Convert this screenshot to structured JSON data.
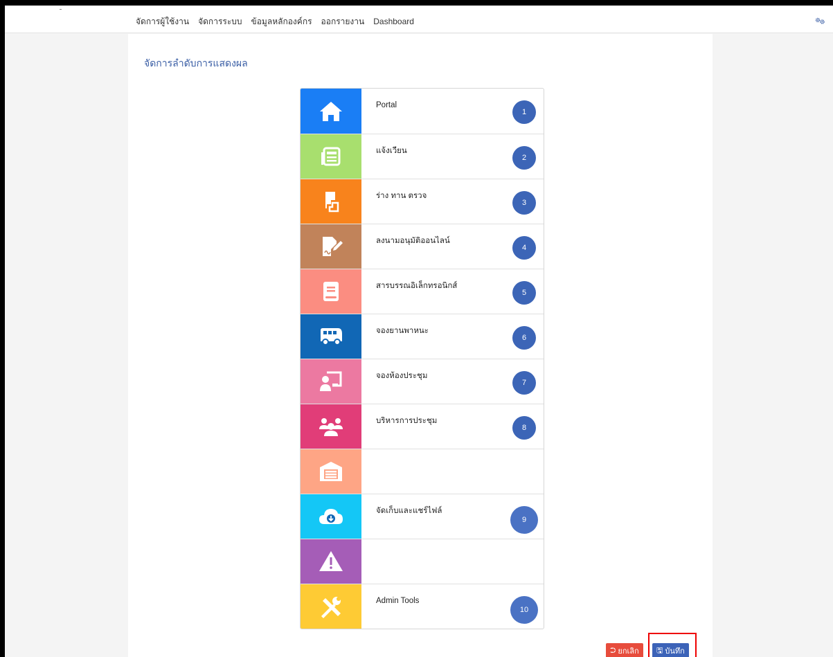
{
  "nav": {
    "items": [
      "จัดการผู้ใช้งาน",
      "จัดการระบบ",
      "ข้อมูลหลักองค์กร",
      "ออกรายงาน",
      "Dashboard"
    ],
    "settings_icon": "gears-icon"
  },
  "page": {
    "title": "จัดการลำดับการแสดงผล"
  },
  "modules": [
    {
      "label": "Portal",
      "order": "1",
      "color": "#1a7ef5",
      "icon": "home-icon"
    },
    {
      "label": "แจ้งเวียน",
      "order": "2",
      "color": "#a8df6e",
      "icon": "newspaper-icon"
    },
    {
      "label": "ร่าง ทาน ตรวจ",
      "order": "3",
      "color": "#f8831c",
      "icon": "draft-icon"
    },
    {
      "label": "ลงนามอนุมัติออนไลน์",
      "order": "4",
      "color": "#c1835a",
      "icon": "signature-icon"
    },
    {
      "label": "สารบรรณอิเล็กทรอนิกส์",
      "order": "5",
      "color": "#fb8d81",
      "icon": "book-icon"
    },
    {
      "label": "จองยานพาหนะ",
      "order": "6",
      "color": "#1167b5",
      "icon": "van-icon"
    },
    {
      "label": "จองห้องประชุม",
      "order": "7",
      "color": "#ec79a1",
      "icon": "presentation-icon"
    },
    {
      "label": "บริหารการประชุม",
      "order": "8",
      "color": "#e13d78",
      "icon": "users-icon"
    },
    {
      "label": "",
      "order": "",
      "color": "#fea585",
      "icon": "warehouse-icon"
    },
    {
      "label": "จัดเก็บและแชร์ไฟล์",
      "order": "9",
      "color": "#14c7f6",
      "icon": "cloud-download-icon"
    },
    {
      "label": "",
      "order": "",
      "color": "#a55db7",
      "icon": "warning-icon"
    },
    {
      "label": "Admin Tools",
      "order": "10",
      "color": "#fecb34",
      "icon": "tools-icon"
    }
  ],
  "actions": {
    "cancel_label": "ยกเลิก",
    "save_label": "บันทึก",
    "cancel_color": "#e74c3c",
    "save_color": "#3c63b8"
  }
}
